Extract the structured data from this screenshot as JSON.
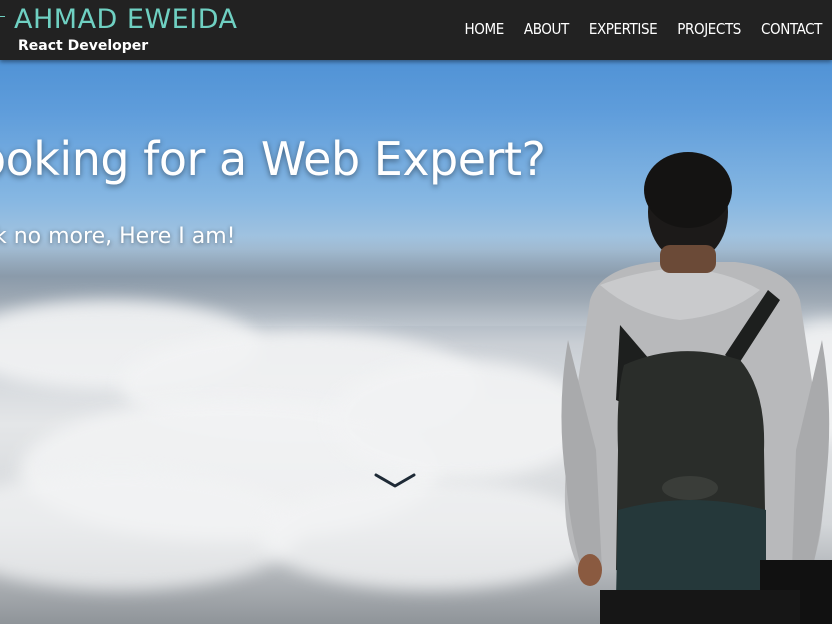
{
  "brand": {
    "name": "AHMAD EWEIDA",
    "tagline": "React Developer"
  },
  "nav": {
    "items": [
      {
        "label": "HOME"
      },
      {
        "label": "ABOUT"
      },
      {
        "label": "EXPERTISE"
      },
      {
        "label": "PROJECTS"
      },
      {
        "label": "CONTACT"
      }
    ]
  },
  "hero": {
    "headline": "ooking for a Web Expert?",
    "subheadline": "k no more, Here I am!",
    "scroll_icon": "chevron-down-icon"
  },
  "colors": {
    "navbar_bg": "#222222",
    "brand_accent": "#6fd0c2",
    "text": "#ffffff"
  }
}
